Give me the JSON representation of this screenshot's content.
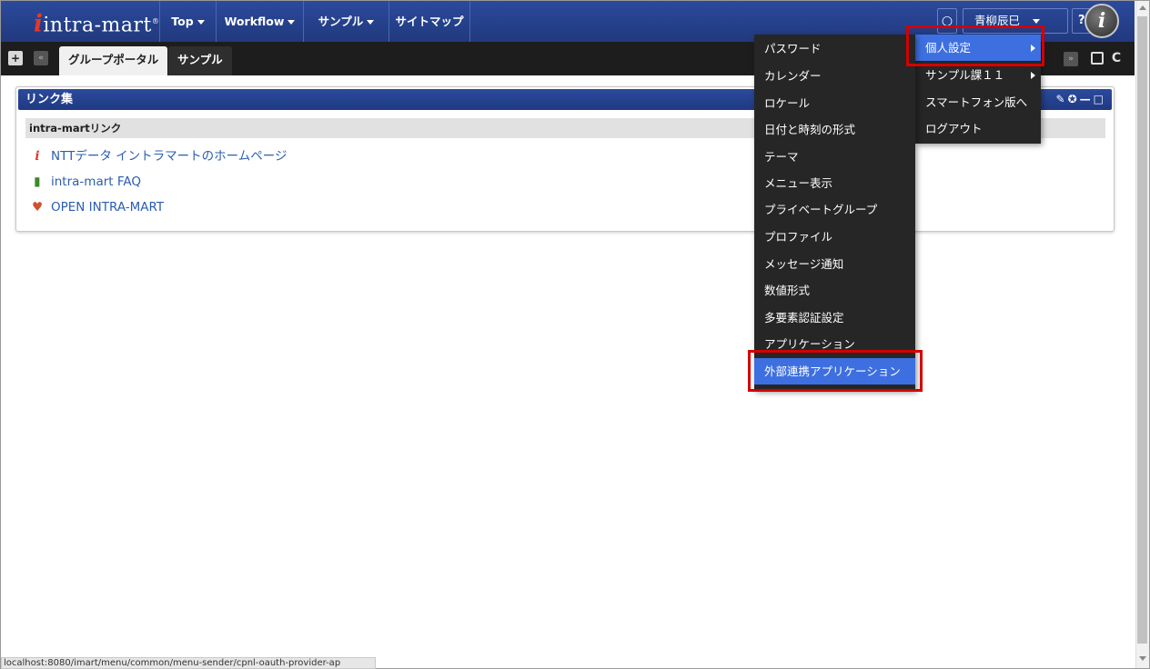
{
  "header": {
    "logo_text": "intra-mart",
    "nav": [
      {
        "label": "Top",
        "has_caret": true
      },
      {
        "label": "Workflow",
        "has_caret": true
      },
      {
        "label": "サンプル",
        "has_caret": true
      },
      {
        "label": "サイトマップ",
        "has_caret": false
      }
    ],
    "user_name": "青柳辰巳",
    "help_label": "?"
  },
  "tabs": [
    {
      "label": "グループポータル",
      "active": true
    },
    {
      "label": "サンプル",
      "active": false
    }
  ],
  "portlet": {
    "title": "リンク集",
    "section_title": "intra-martリンク",
    "links": [
      {
        "label": "NTTデータ イントラマートのホームページ",
        "icon": "intra-mart-logo-icon"
      },
      {
        "label": "intra-mart FAQ",
        "icon": "faq-icon"
      },
      {
        "label": "OPEN INTRA-MART",
        "icon": "open-intra-mart-icon"
      }
    ]
  },
  "user_menu": [
    {
      "label": "個人設定",
      "submenu": true,
      "selected": true
    },
    {
      "label": "サンプル課１１",
      "submenu": true,
      "selected": false
    },
    {
      "label": "スマートフォン版へ",
      "submenu": false,
      "selected": false
    },
    {
      "label": "ログアウト",
      "submenu": false,
      "selected": false
    }
  ],
  "personal_settings_menu": [
    {
      "label": "パスワード"
    },
    {
      "label": "カレンダー"
    },
    {
      "label": "ロケール"
    },
    {
      "label": "日付と時刻の形式"
    },
    {
      "label": "テーマ"
    },
    {
      "label": "メニュー表示"
    },
    {
      "label": "プライベートグループ"
    },
    {
      "label": "プロファイル"
    },
    {
      "label": "メッセージ通知"
    },
    {
      "label": "数値形式"
    },
    {
      "label": "多要素認証設定"
    },
    {
      "label": "アプリケーション"
    },
    {
      "label": "外部連携アプリケーション",
      "selected": true
    }
  ],
  "status_url": "localhost:8080/imart/menu/common/menu-sender/cpnl-oauth-provider-ap",
  "colors": {
    "header_blue": "#2b4a9c",
    "menu_bg": "#262626",
    "menu_selected": "#3d6fe0",
    "highlight_red": "#d40000",
    "link_blue": "#2a5db0"
  }
}
